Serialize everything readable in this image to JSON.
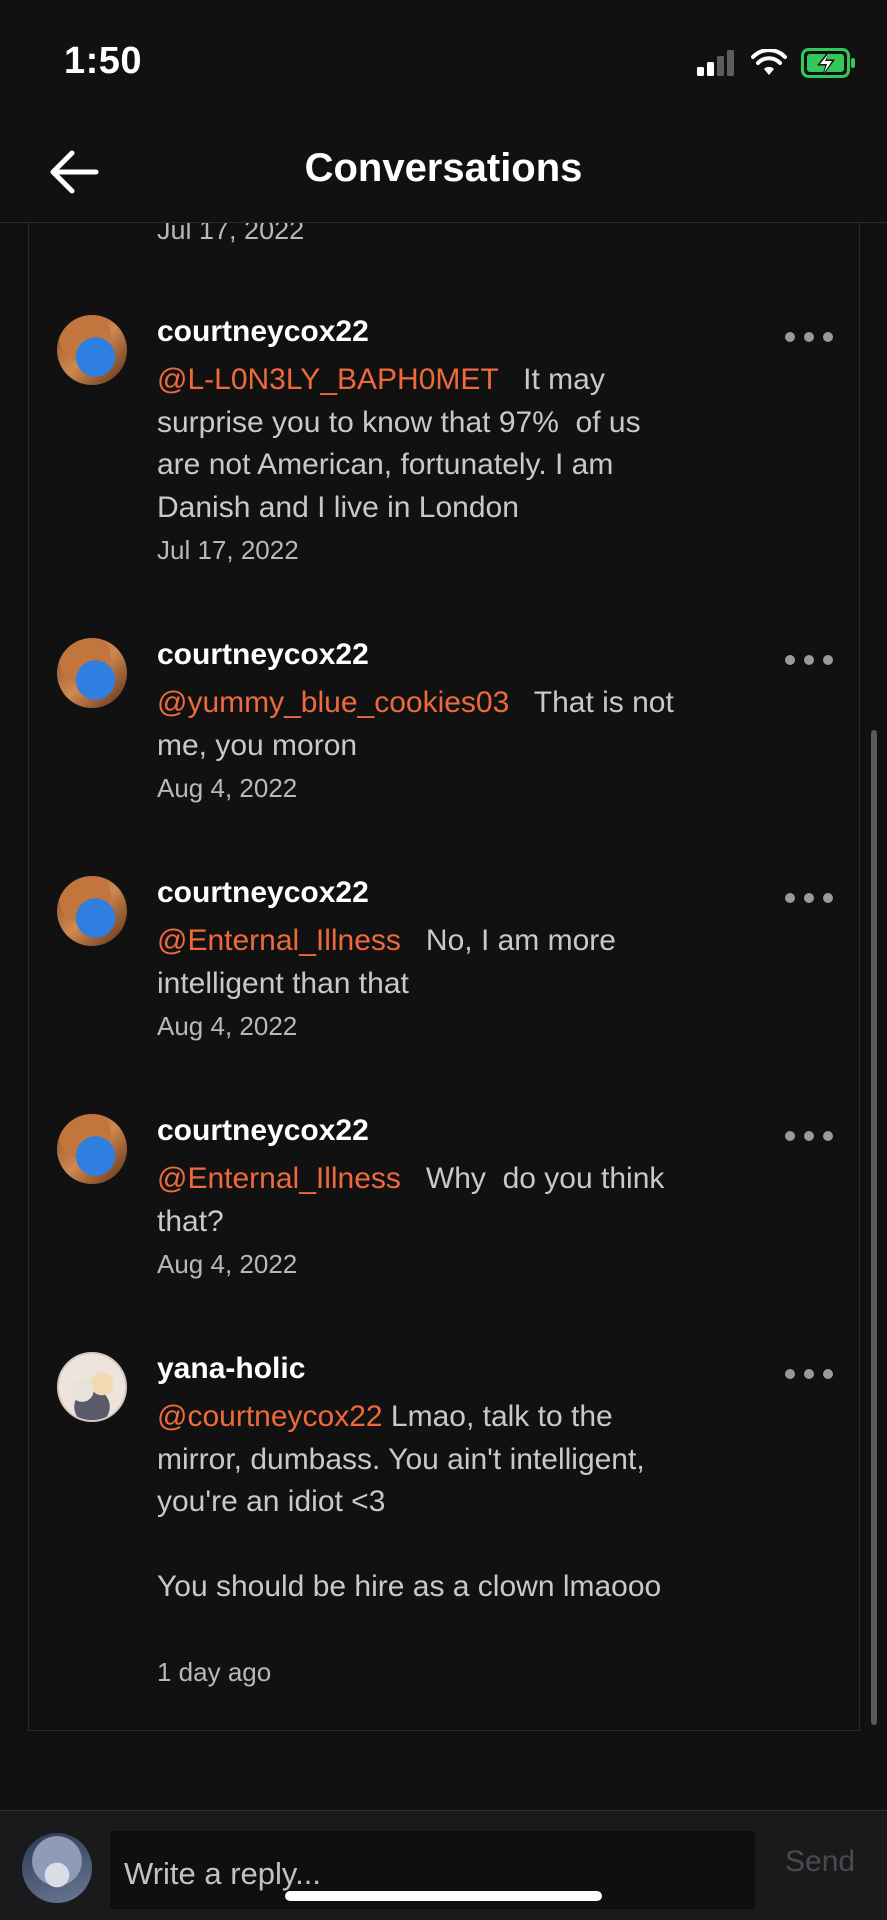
{
  "status_bar": {
    "time": "1:50",
    "icons": [
      "cellular-signal-icon",
      "wifi-icon",
      "battery-charging-icon"
    ],
    "battery_color": "#34c759"
  },
  "header": {
    "title": "Conversations",
    "back_icon": "back-arrow-icon"
  },
  "thread": {
    "top_date": "Jul 17, 2022",
    "comments": [
      {
        "username": "courtneycox22",
        "mention": "@L-L0N3LY_BAPH0MET",
        "text": "   It may surprise you to know that 97%  of us are not American, fortunately. I am Danish and I live in London",
        "date": "Jul 17, 2022"
      },
      {
        "username": "courtneycox22",
        "mention": "@yummy_blue_cookies03",
        "text": "   That is not me, you moron",
        "date": "Aug 4, 2022"
      },
      {
        "username": "courtneycox22",
        "mention": "@Enternal_Illness",
        "text": "   No, I am more intelligent than that",
        "date": "Aug 4, 2022"
      },
      {
        "username": "courtneycox22",
        "mention": "@Enternal_Illness",
        "text": "   Why  do you think that?",
        "date": "Aug 4, 2022"
      },
      {
        "username": "yana-holic",
        "mention": "@courtneycox22",
        "text": " Lmao, talk to the mirror, dumbass. You ain't intelligent, you're an idiot <3\n\nYou should be hire as a clown lmaooo",
        "date": "1 day ago"
      }
    ]
  },
  "reply_bar": {
    "placeholder": "Write a reply...",
    "send_label": "Send"
  },
  "colors": {
    "background": "#111112",
    "mention": "#ee6a3c",
    "body_text": "#c9c9cc"
  }
}
